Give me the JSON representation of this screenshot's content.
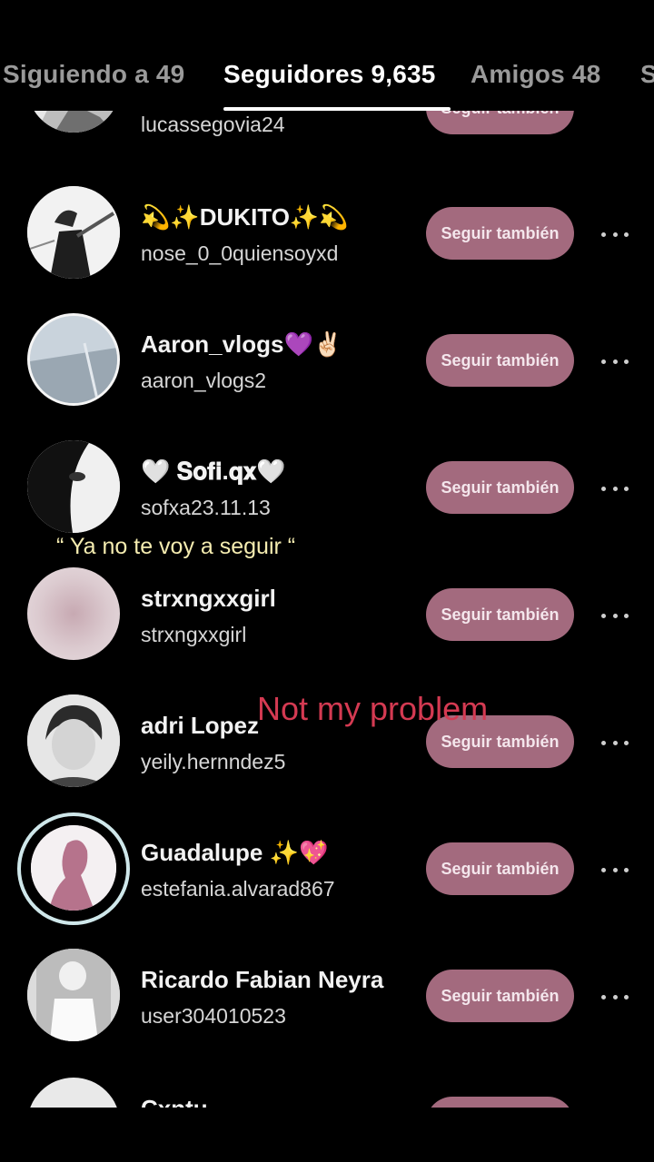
{
  "tabs": {
    "following": "Siguiendo a 49",
    "followers": "Seguidores 9,635",
    "friends": "Amigos 48",
    "next_partial": "S"
  },
  "follow_label": "Seguir también",
  "rows": [
    {
      "name": "",
      "user": "lucassegovia24"
    },
    {
      "name": "💫✨DUKITO✨💫",
      "user": "nose_0_0quiensoyxd"
    },
    {
      "name": "Aaron_vlogs💜✌🏻",
      "user": "aaron_vlogs2"
    },
    {
      "name": "🤍 𝐒𝐨𝐟𝐢.𝐪𝐱🤍",
      "user": "sofxa23.11.13"
    },
    {
      "name": "strxngxxgirl",
      "user": "strxngxxgirl"
    },
    {
      "name": "adri Lopez",
      "user": "yeily.hernndez5"
    },
    {
      "name": "Guadalupe ✨💖",
      "user": "estefania.alvarad867"
    },
    {
      "name": "Ricardo Fabian Neyra",
      "user": "user304010523"
    },
    {
      "name": "Cxntu",
      "user": ""
    }
  ],
  "overlays": {
    "caption": "“ Ya no te voy a seguir “",
    "problem": "Not my problem"
  },
  "colors": {
    "button_bg": "#a36a7e",
    "caption": "#f5ecb0",
    "problem": "#d43a52"
  }
}
